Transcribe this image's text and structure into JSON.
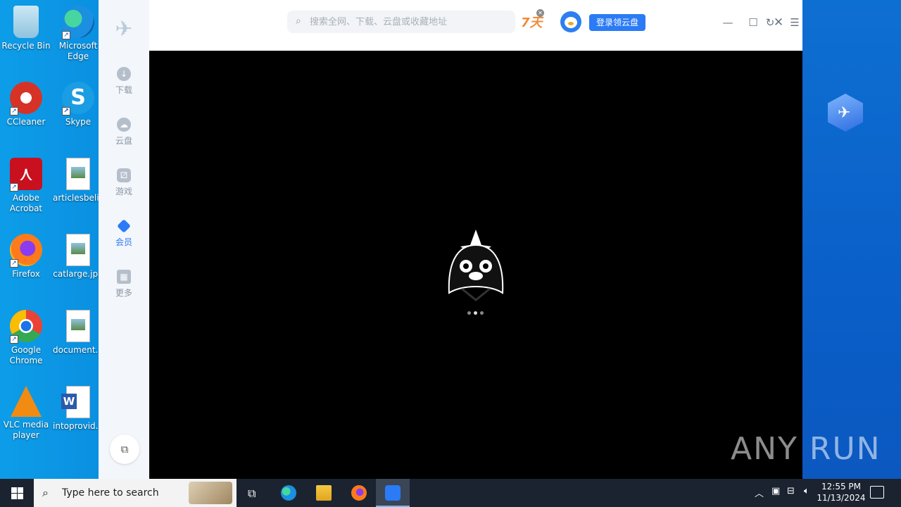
{
  "desktop": {
    "icons": [
      {
        "label": "Recycle Bin",
        "icon": "recycle-bin-icon"
      },
      {
        "label": "Microsoft Edge",
        "icon": "edge-icon"
      },
      {
        "label": "CCleaner",
        "icon": "ccleaner-icon"
      },
      {
        "label": "Skype",
        "icon": "skype-icon",
        "glyph": "S"
      },
      {
        "label": "Adobe Acrobat",
        "icon": "acrobat-icon"
      },
      {
        "label": "articlesbeli...",
        "icon": "image-file-icon"
      },
      {
        "label": "Firefox",
        "icon": "firefox-icon"
      },
      {
        "label": "catlarge.jpg",
        "icon": "image-file-icon"
      },
      {
        "label": "Google Chrome",
        "icon": "chrome-icon"
      },
      {
        "label": "document...",
        "icon": "image-file-icon"
      },
      {
        "label": "VLC media player",
        "icon": "vlc-icon"
      },
      {
        "label": "intoprovid...",
        "icon": "word-file-icon"
      }
    ]
  },
  "app": {
    "sidebar": {
      "items": [
        {
          "label": "下载",
          "icon": "download-icon"
        },
        {
          "label": "云盘",
          "icon": "cloud-icon"
        },
        {
          "label": "游戏",
          "icon": "gamepad-icon"
        },
        {
          "label": "会员",
          "icon": "diamond-icon",
          "active": true
        },
        {
          "label": "更多",
          "icon": "apps-icon"
        }
      ]
    },
    "topbar": {
      "search_placeholder": "搜索全网、下载、云盘或收藏地址",
      "promo_text": "7天",
      "login_button": "登录领云盘"
    },
    "accent_color": "#2a7bf5"
  },
  "watermark": "ANY RUN",
  "taskbar": {
    "search_placeholder": "Type here to search",
    "time": "12:55 PM",
    "date": "11/13/2024"
  }
}
